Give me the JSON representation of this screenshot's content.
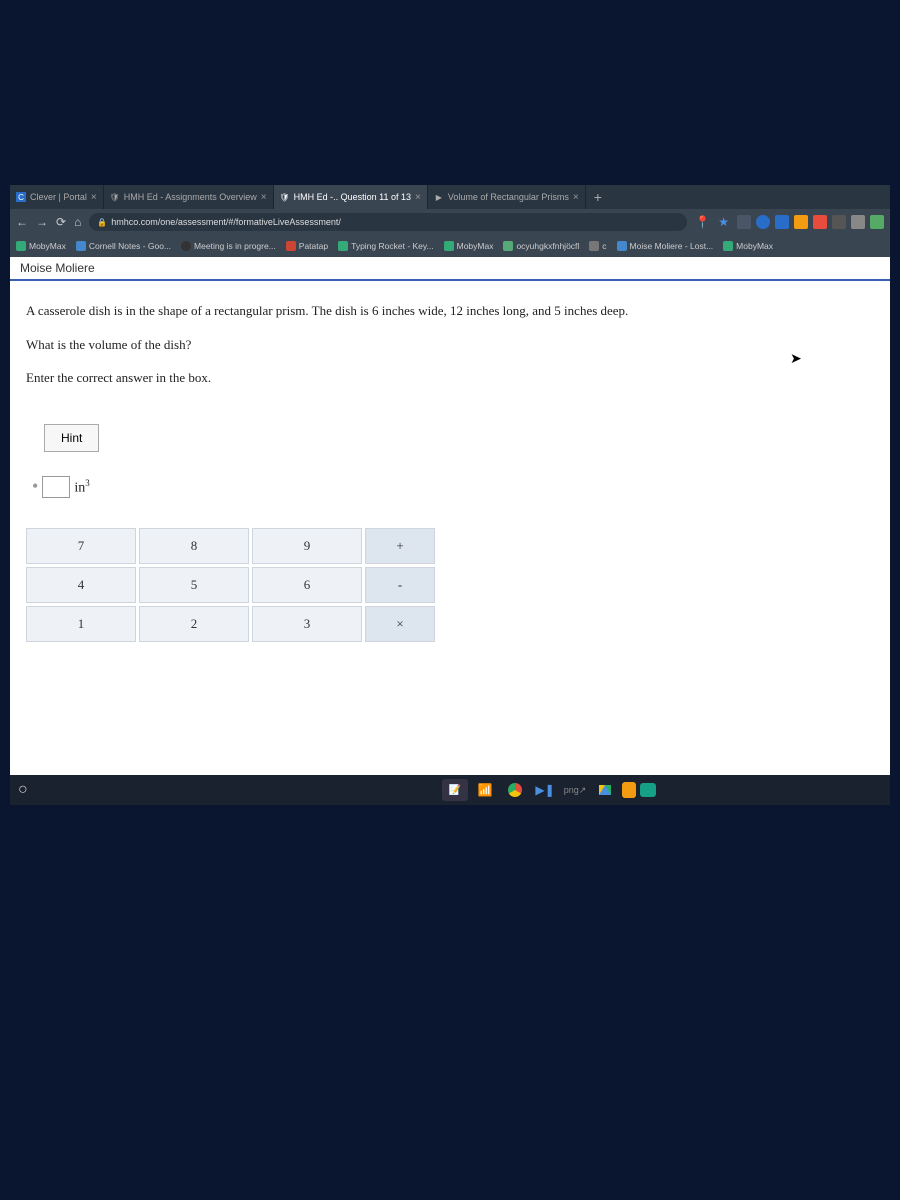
{
  "tabs": [
    {
      "label": "Clever | Portal"
    },
    {
      "label": "HMH Ed - Assignments Overview"
    },
    {
      "label": "HMH Ed -.. Question 11 of 13"
    },
    {
      "label": "Volume of Rectangular Prisms"
    }
  ],
  "url": "hmhco.com/one/assessment/#/formativeLiveAssessment/",
  "bookmarks": [
    {
      "label": "MobyMax"
    },
    {
      "label": "Cornell Notes - Goo..."
    },
    {
      "label": "Meeting is in progre..."
    },
    {
      "label": "Patatap"
    },
    {
      "label": "Typing Rocket - Key..."
    },
    {
      "label": "MobyMax"
    },
    {
      "label": "ocyuhgkxfnhjöcfl"
    },
    {
      "label": "c"
    },
    {
      "label": "Moise Moliere - Lost..."
    },
    {
      "label": "MobyMax"
    }
  ],
  "student": "Moise Moliere",
  "question": {
    "line1": "A casserole dish is in the shape of a rectangular prism. The dish is 6 inches wide, 12 inches long, and 5 inches deep.",
    "line2": "What is the volume of the dish?",
    "line3": "Enter the correct answer in the box."
  },
  "hint_label": "Hint",
  "unit": "in",
  "unit_exp": "3",
  "keypad": {
    "r1": [
      "7",
      "8",
      "9",
      "+"
    ],
    "r2": [
      "4",
      "5",
      "6",
      "-"
    ],
    "r3": [
      "1",
      "2",
      "3",
      "×"
    ]
  }
}
